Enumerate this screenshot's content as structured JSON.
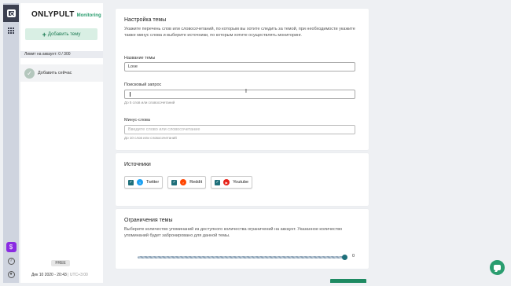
{
  "brand": {
    "name": "ONLYPULT",
    "product": "Monitoring"
  },
  "sidebar": {
    "add_topic_label": "Добавить тему",
    "limit_text": "Лимит на аккаунт: 0 / 300",
    "add_now_label": "Добавить сейчас",
    "plan_badge": "FREE",
    "datetime": "Дек 10 2020 - 20:43",
    "timezone": "UTC+3:00"
  },
  "topic_settings": {
    "title": "Настройка темы",
    "description": "Укажите перечень слов или словосочетаний, по которым вы хотите следить за темой, при необходимости укажите также минус слова и выберите источники, по которым хотите осуществлять мониторинг.",
    "name_label": "Название темы",
    "name_value": "Love",
    "query_label": "Поисковый запрос",
    "query_value": "",
    "query_hint": "До 5 слов или словосочетаний",
    "minus_label": "Минус-слова",
    "minus_placeholder": "Введите слово или словосочетание",
    "minus_hint": "До 10 слов или словосочетаний"
  },
  "sources": {
    "title": "Источники",
    "items": [
      {
        "label": "Twitter",
        "checked": true,
        "color": "#1da1f2",
        "icon": "twitter-icon"
      },
      {
        "label": "Reddit",
        "checked": true,
        "color": "#ff4500",
        "icon": "reddit-icon"
      },
      {
        "label": "Youtube",
        "checked": true,
        "color": "#e62117",
        "icon": "youtube-icon"
      }
    ]
  },
  "limits": {
    "title": "Ограничения темы",
    "description": "Выберите количество упоминаний из доступного количества ограничений на аккаунт. Указанное количество упоминаний будет забронировано для данной темы.",
    "slider_value": "0",
    "slider_fill": 1.0
  },
  "colors": {
    "accent": "#1e6f7a",
    "brand_green": "#2a9d6f",
    "rail": "#cfd4df"
  }
}
